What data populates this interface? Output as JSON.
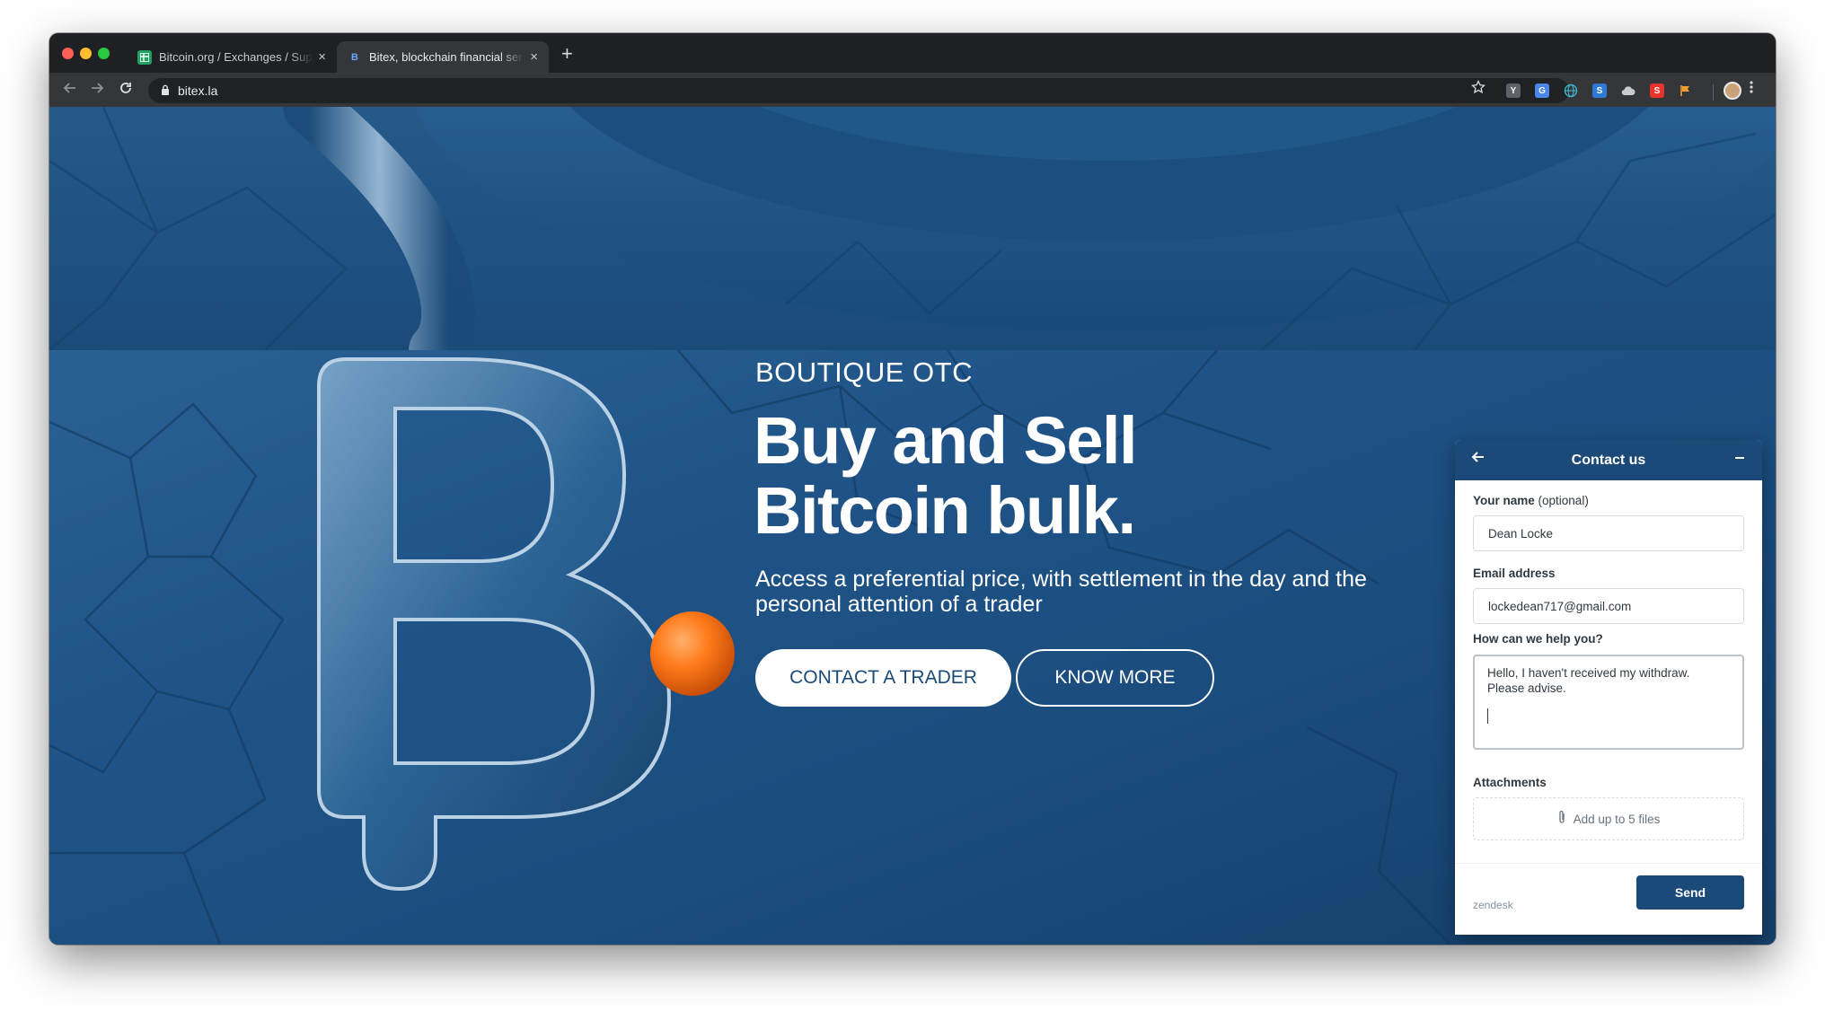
{
  "browser": {
    "tabs": [
      {
        "title": "Bitcoin.org / Exchanges / Supp",
        "favicon": "sheets-icon",
        "active": false
      },
      {
        "title": "Bitex, blockchain financial serv",
        "favicon": "bitex-icon",
        "active": true
      }
    ],
    "close_glyph": "×",
    "new_tab_glyph": "+",
    "address": "bitex.la"
  },
  "hero": {
    "eyebrow": "BOUTIQUE OTC",
    "headline_line1": "Buy and Sell",
    "headline_line2": "Bitcoin bulk.",
    "subtext": "Access a preferential price, with settlement in the day and the personal attention of a trader",
    "primary_button": "CONTACT A TRADER",
    "secondary_button": "KNOW MORE",
    "accent_color": "#ff7a1a",
    "background_color": "#1b4c7a"
  },
  "contact_widget": {
    "title": "Contact us",
    "name_label": "Your name",
    "name_optional": "(optional)",
    "name_value": "Dean Locke",
    "email_label": "Email address",
    "email_value": "lockedean717@gmail.com",
    "help_label": "How can we help you?",
    "help_value": "Hello, I haven't received my withdraw. Please advise.",
    "attachments_label": "Attachments",
    "attachments_hint": "Add up to 5 files",
    "brand": "zendesk",
    "send_label": "Send",
    "header_color": "#1c4a78"
  }
}
